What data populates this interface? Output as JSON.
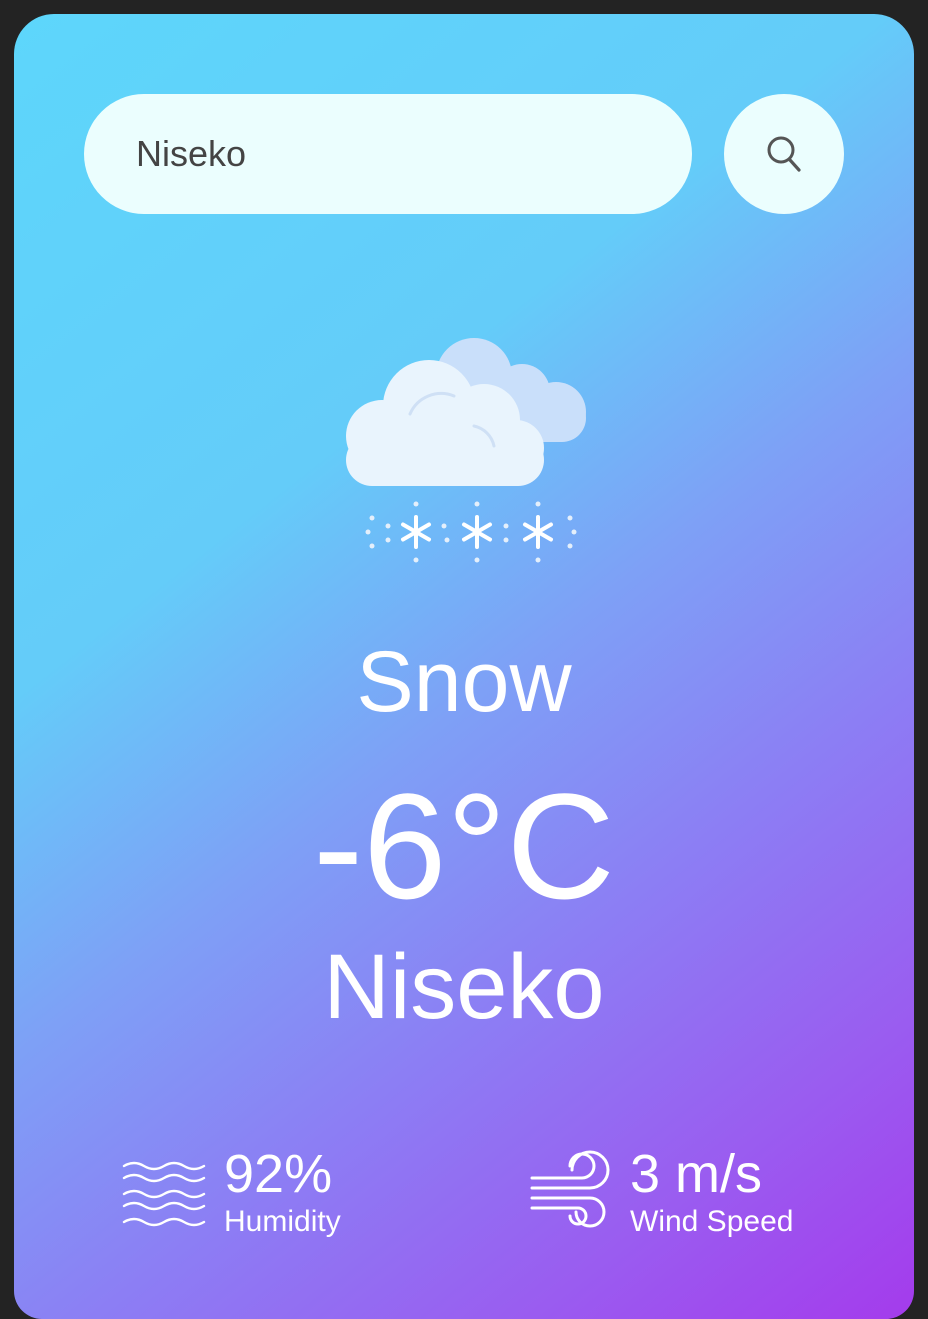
{
  "search": {
    "value": "Niseko"
  },
  "weather": {
    "condition": "Snow",
    "temperature": "-6°C",
    "city": "Niseko"
  },
  "stats": {
    "humidity": {
      "value": "92%",
      "label": "Humidity",
      "icon": "humidity-waves-icon"
    },
    "wind": {
      "value": "3 m/s",
      "label": "Wind Speed",
      "icon": "wind-icon"
    }
  },
  "icons": {
    "search": "search-icon",
    "weather": "snow-cloud-icon"
  },
  "colors": {
    "gradient_start": "#5dd6fb",
    "gradient_end": "#a43bec",
    "input_bg": "#ebfefe",
    "text": "#ffffff"
  }
}
